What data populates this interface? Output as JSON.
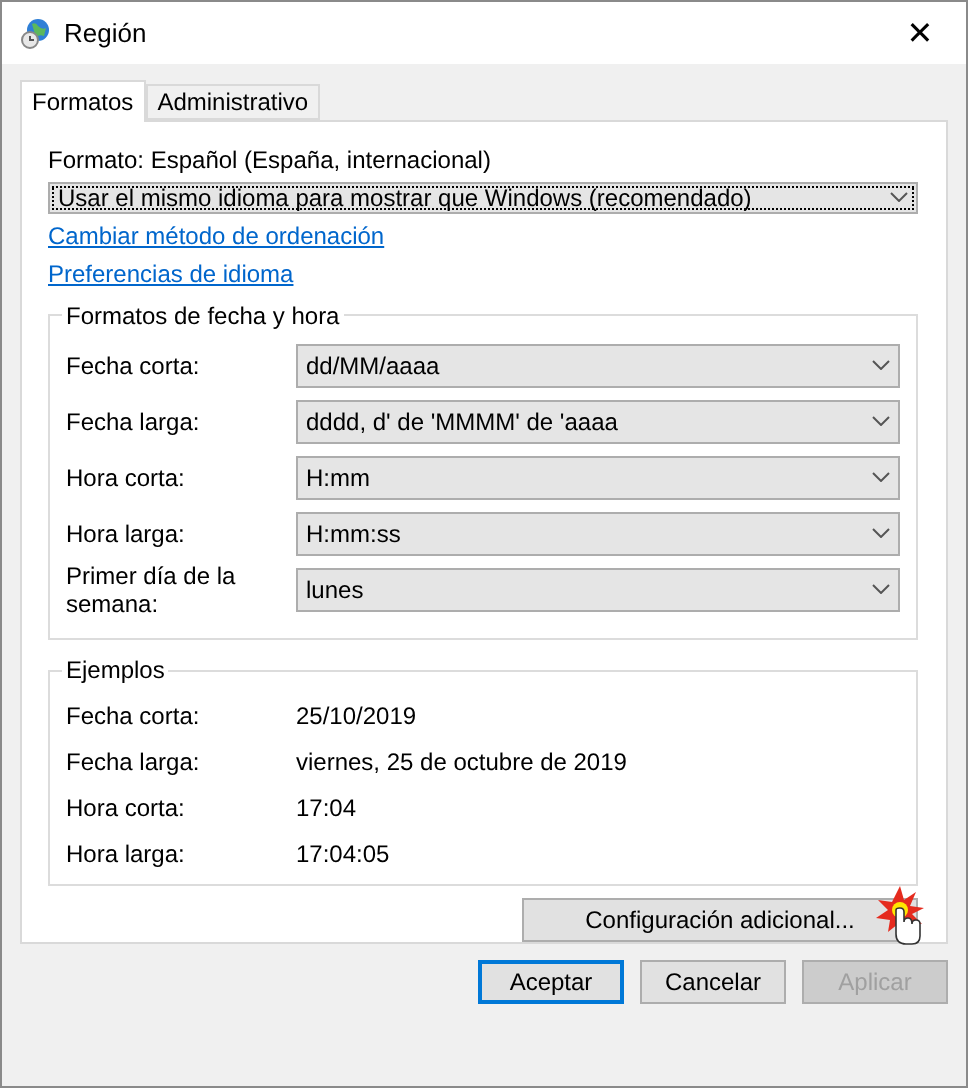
{
  "window": {
    "title": "Región",
    "close": "✕"
  },
  "tabs": [
    {
      "label": "Formatos",
      "selected": true
    },
    {
      "label": "Administrativo",
      "selected": false
    }
  ],
  "format": {
    "label": "Formato: Español (España, internacional)",
    "value": "Usar el mismo idioma para mostrar que Windows (recomendado)"
  },
  "links": [
    "Cambiar método de ordenación",
    "Preferencias de idioma"
  ],
  "date_time_formats": {
    "title": "Formatos de fecha y hora",
    "rows": [
      {
        "label": "Fecha corta:",
        "value": "dd/MM/aaaa"
      },
      {
        "label": "Fecha larga:",
        "value": "dddd, d' de 'MMMM' de 'aaaa"
      },
      {
        "label": "Hora corta:",
        "value": "H:mm"
      },
      {
        "label": "Hora larga:",
        "value": "H:mm:ss"
      },
      {
        "label": "Primer día de la semana:",
        "value": "lunes"
      }
    ]
  },
  "examples": {
    "title": "Ejemplos",
    "rows": [
      {
        "label": "Fecha corta:",
        "value": "25/10/2019"
      },
      {
        "label": "Fecha larga:",
        "value": "viernes, 25 de octubre de 2019"
      },
      {
        "label": "Hora corta:",
        "value": "17:04"
      },
      {
        "label": "Hora larga:",
        "value": "17:04:05"
      }
    ]
  },
  "additional_button": "Configuración adicional...",
  "buttons": [
    {
      "label": "Aceptar",
      "default": true,
      "disabled": false
    },
    {
      "label": "Cancelar",
      "default": false,
      "disabled": false
    },
    {
      "label": "Aplicar",
      "default": false,
      "disabled": true
    }
  ]
}
